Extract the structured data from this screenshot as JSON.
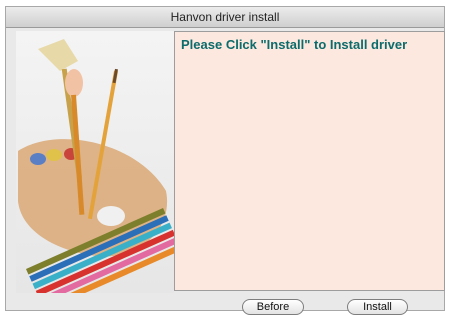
{
  "window": {
    "title": "Hanvon driver install"
  },
  "message": "Please Click \"Install\" to Install driver",
  "buttons": {
    "before": "Before",
    "install": "Install"
  },
  "colors": {
    "message_text": "#0c6b6b",
    "message_bg": "#fde8df",
    "window_bg": "#e9e9e9"
  },
  "icons": [
    "paintbrush-palette-illustration"
  ]
}
